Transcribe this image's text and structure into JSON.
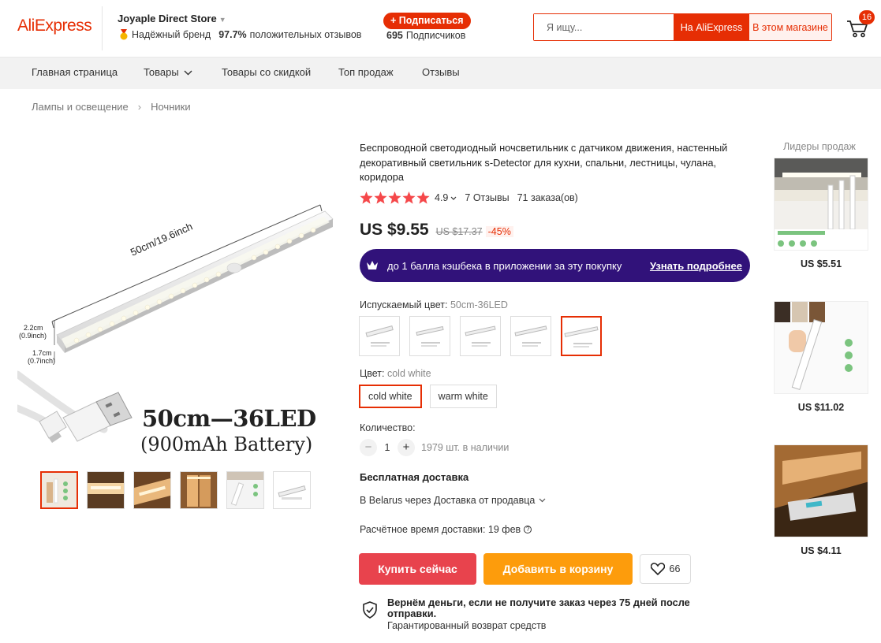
{
  "header": {
    "logo": "AliExpress",
    "store_name": "Joyaple Direct Store",
    "brand_label": "Надёжный бренд",
    "feedback_percent": "97.7%",
    "feedback_label": "положительных отзывов",
    "subscribe_label": "+ Подписаться",
    "subscribers_count": "695",
    "subscribers_label": "Подписчиков",
    "search_placeholder": "Я ищу...",
    "search_ali_label": "На AliExpress",
    "search_store_label": "В этом магазине",
    "cart_count": "16"
  },
  "nav": {
    "items": [
      "Главная страница",
      "Товары",
      "Товары со скидкой",
      "Топ продаж",
      "Отзывы"
    ]
  },
  "breadcrumb": [
    "Лампы и освещение",
    "Ночники"
  ],
  "gallery": {
    "dim_length": "50cm/19.6inch",
    "dim_height_cm": "2.2cm",
    "dim_height_in": "(0.9inch)",
    "dim_width_cm": "1.7cm",
    "dim_width_in": "(0.7inch)",
    "caption_main": "50cm—36LED",
    "caption_sub": "(900mAh Battery)"
  },
  "product": {
    "title": "Беспроводной светодиодный ночсветильник с датчиком движения, настенный декоративный светильник s-Detector для кухни, спальни, лестницы, чулана, коридора",
    "rating": "4.9",
    "reviews": "7 Отзывы",
    "orders": "71 заказа(ов)",
    "price": "US $9.55",
    "old_price": "US $17.37",
    "discount": "-45%",
    "cashback_text": "до 1 балла кэшбека в приложении за эту покупку",
    "cashback_link": "Узнать подробнее",
    "emitting_color_label": "Испускаемый цвет:",
    "emitting_color_value": "50cm-36LED",
    "color_label": "Цвет:",
    "color_value": "cold white",
    "color_options": [
      "cold white",
      "warm white"
    ],
    "quantity_label": "Количество:",
    "quantity": "1",
    "stock": "1979 шт. в наличии",
    "shipping_title": "Бесплатная доставка",
    "shipping_dest": "В Belarus через Доставка от продавца",
    "eta": "Расчётное время доставки: 19 фев",
    "buy_now": "Купить сейчас",
    "add_to_cart": "Добавить в корзину",
    "wishlist_count": "66",
    "guarantee_title": "Вернём деньги, если не получите заказ через 75 дней после отправки.",
    "guarantee_sub": "Гарантированный возврат средств"
  },
  "sidebar": {
    "title": "Лидеры продаж",
    "prices": [
      "US $5.51",
      "US $11.02",
      "US $4.11"
    ]
  },
  "colors": {
    "accent": "#e62e04",
    "buy": "#e8434d",
    "cart": "#fd9c0c",
    "cashback_bg": "#31127a"
  }
}
